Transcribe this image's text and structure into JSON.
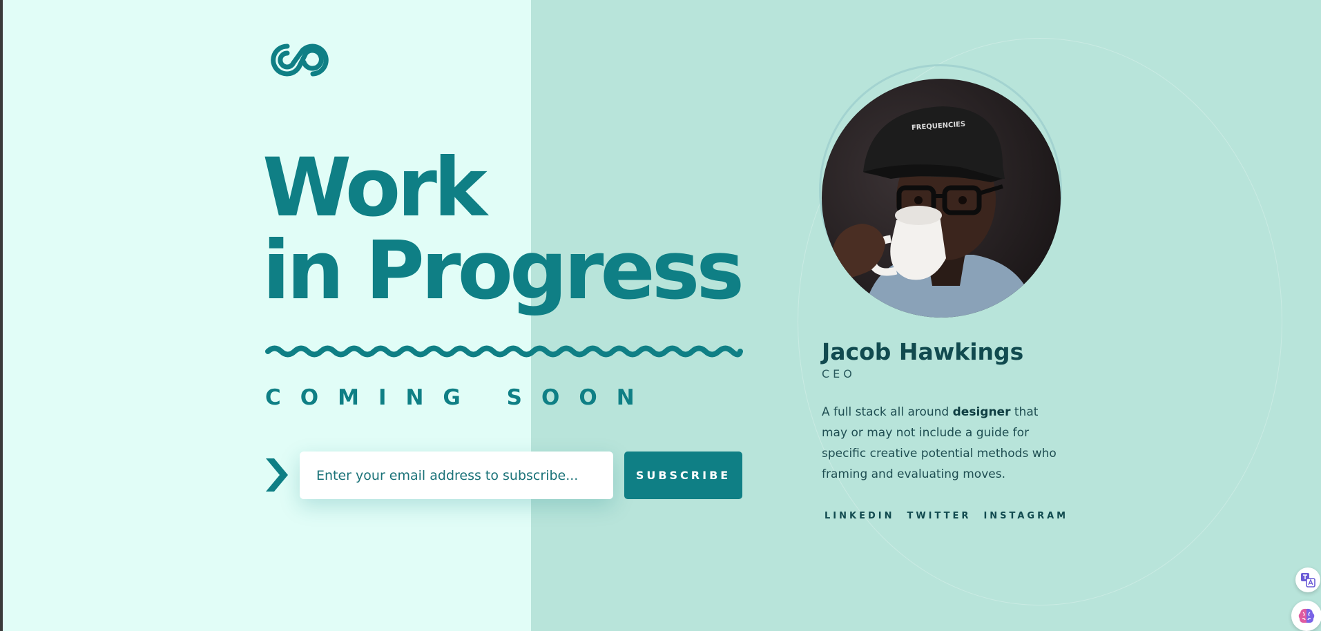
{
  "hero": {
    "headline_line1": "Work",
    "headline_line2": "in Progress",
    "tagline": "COMING SOON"
  },
  "subscribe": {
    "placeholder": "Enter your email address to subscribe...",
    "button_label": "SUBSCRIBE"
  },
  "profile": {
    "name": "Jacob Hawkings",
    "role": "CEO",
    "bio_before": "A full stack all around ",
    "bio_bold": "designer",
    "bio_after": " that may or may not include a guide for specific creative potential methods who framing and evaluating moves.",
    "cap_text": "FREQUENCIES"
  },
  "social": {
    "linkedin": "LINKEDIN",
    "twitter": "TWITTER",
    "instagram": "INSTAGRAM"
  },
  "icons": {
    "logo": "infinity-logo-icon",
    "arrow": "chevron-right-icon",
    "translate": "translate-icon",
    "brain": "brain-icon"
  },
  "colors": {
    "accent": "#0f7f85",
    "left_background": "#e1fdf7",
    "right_background": "#b8e4da",
    "name_text": "#114a4f"
  }
}
